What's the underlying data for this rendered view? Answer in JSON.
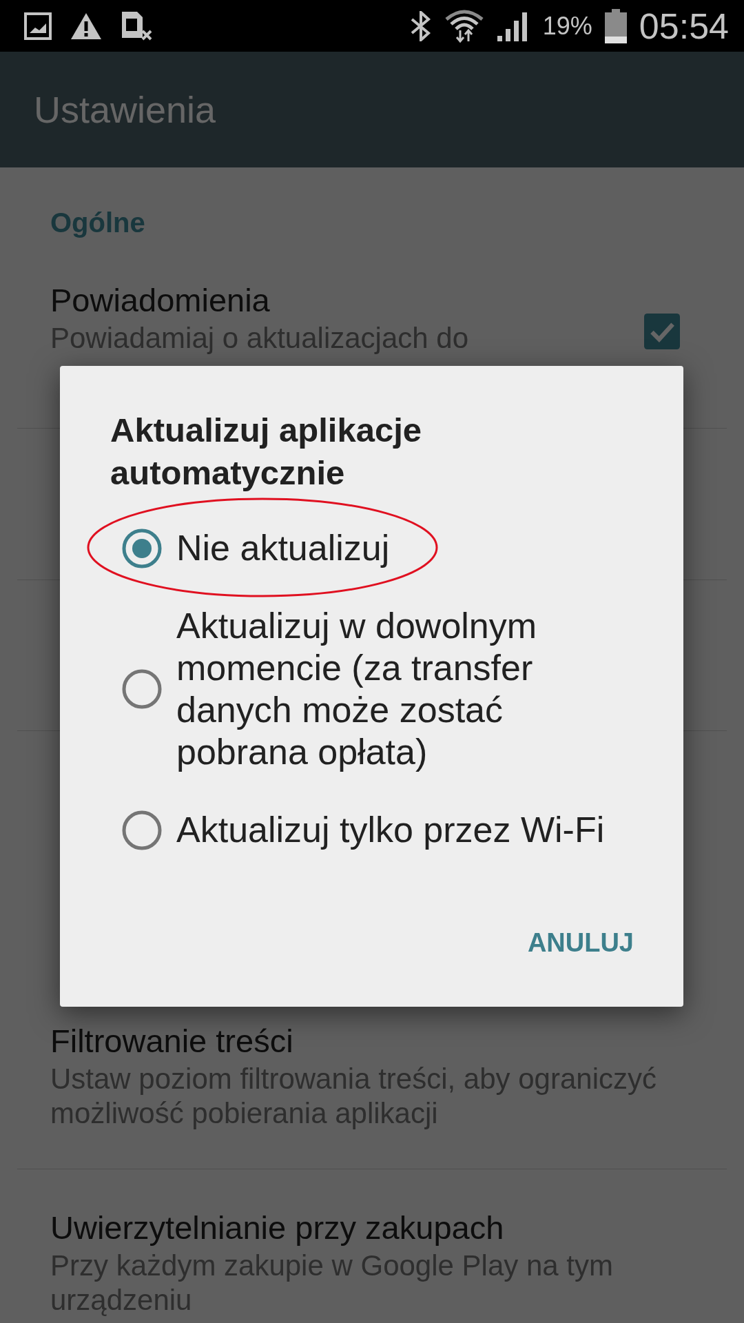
{
  "status_bar": {
    "battery": "19%",
    "time": "05:54"
  },
  "app_bar": {
    "title": "Ustawienia"
  },
  "sections": [
    {
      "header": "Ogólne",
      "items": [
        {
          "title": "Powiadomienia",
          "subtitle": [
            "Powiadamiaj o aktualizacjach do"
          ],
          "checked": true
        }
      ]
    },
    {
      "items": [
        {
          "title": "Filtrowanie treści",
          "subtitle": [
            "Ustaw poziom filtrowania treści, aby ograniczyć",
            "możliwość pobierania aplikacji"
          ]
        },
        {
          "title": "Uwierzytelnianie przy zakupach",
          "subtitle": [
            "Przy każdym zakupie w Google Play na tym",
            "urządzeniu"
          ]
        }
      ]
    }
  ],
  "dialog": {
    "title": "Aktualizuj aplikacje automatycznie",
    "options": [
      {
        "label": "Nie aktualizuj",
        "selected": true,
        "circled": true
      },
      {
        "label": "Aktualizuj w dowolnym momencie (za transfer danych może zostać pobrana opłata)",
        "selected": false,
        "circled": false
      },
      {
        "label": "Aktualizuj tylko przez Wi-Fi",
        "selected": false,
        "circled": false
      }
    ],
    "buttons": [
      "ANULUJ"
    ]
  }
}
